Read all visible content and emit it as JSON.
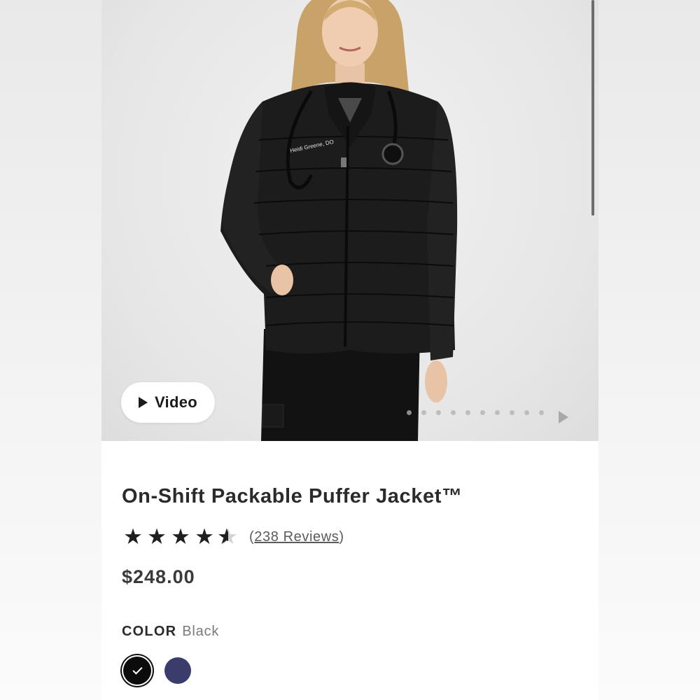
{
  "hero": {
    "video_label": "Video",
    "embroidery_text": "Heidi Greene, DO",
    "carousel": {
      "total_images": 10,
      "active_index": 0
    }
  },
  "product": {
    "title": "On-Shift Packable Puffer Jacket™",
    "rating": 4.5,
    "rating_max": 5,
    "reviews_open": "(",
    "reviews_text": "238 Reviews",
    "reviews_close": ")",
    "price": "$248.00"
  },
  "color": {
    "label": "COLOR",
    "selected": "Black",
    "swatches": [
      {
        "name": "Black",
        "hex": "#0c0c0c",
        "selected": true
      },
      {
        "name": "Navy",
        "hex": "#3a3d6b",
        "selected": false
      }
    ]
  },
  "colors": {
    "accent_text": "#2b2b2b",
    "muted_text": "#7a7a7a"
  }
}
